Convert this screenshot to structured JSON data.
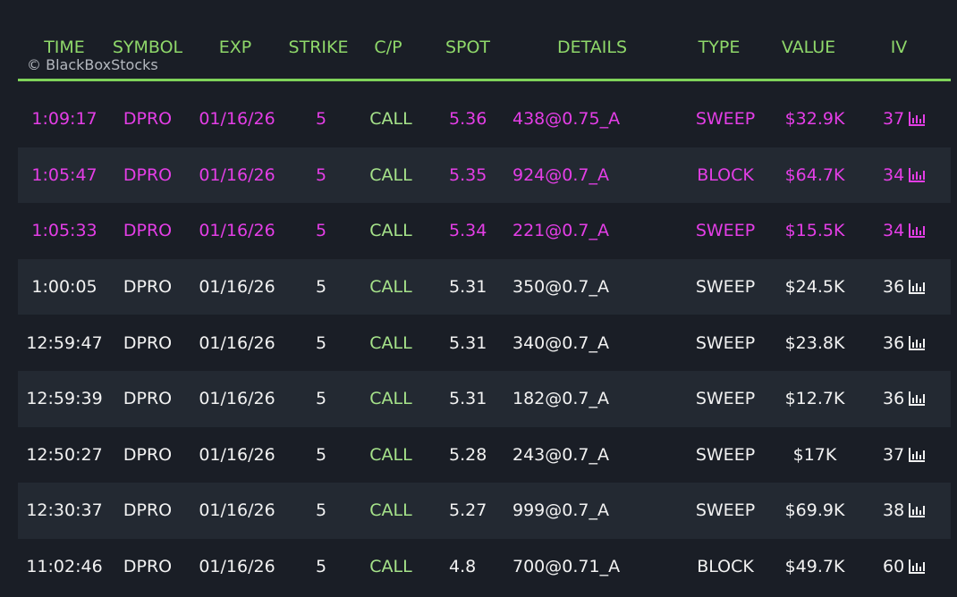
{
  "header": {
    "columns": [
      "TIME",
      "SYMBOL",
      "EXP",
      "STRIKE",
      "C/P",
      "SPOT",
      "DETAILS",
      "TYPE",
      "VALUE",
      "IV"
    ],
    "watermark": "© BlackBoxStocks"
  },
  "colors": {
    "background": "#1a1e26",
    "alt_row": "#232932",
    "header_text": "#8fd86a",
    "divider": "#7fd35a",
    "highlight_row": "#e43ee6",
    "normal_row": "#f2f2f2",
    "call_text": "#a6e38a"
  },
  "rows": [
    {
      "time": "1:09:17",
      "symbol": "DPRO",
      "exp": "01/16/26",
      "strike": "5",
      "cp": "CALL",
      "spot": "5.36",
      "details": "438@0.75_A",
      "type": "SWEEP",
      "value": "$32.9K",
      "iv": "37",
      "icon": "bar-chart-icon",
      "style": "pink"
    },
    {
      "time": "1:05:47",
      "symbol": "DPRO",
      "exp": "01/16/26",
      "strike": "5",
      "cp": "CALL",
      "spot": "5.35",
      "details": "924@0.7_A",
      "type": "BLOCK",
      "value": "$64.7K",
      "iv": "34",
      "icon": "bar-chart-icon",
      "style": "pink"
    },
    {
      "time": "1:05:33",
      "symbol": "DPRO",
      "exp": "01/16/26",
      "strike": "5",
      "cp": "CALL",
      "spot": "5.34",
      "details": "221@0.7_A",
      "type": "SWEEP",
      "value": "$15.5K",
      "iv": "34",
      "icon": "bar-chart-icon",
      "style": "pink"
    },
    {
      "time": "1:00:05",
      "symbol": "DPRO",
      "exp": "01/16/26",
      "strike": "5",
      "cp": "CALL",
      "spot": "5.31",
      "details": "350@0.7_A",
      "type": "SWEEP",
      "value": "$24.5K",
      "iv": "36",
      "icon": "bar-chart-icon",
      "style": "white"
    },
    {
      "time": "12:59:47",
      "symbol": "DPRO",
      "exp": "01/16/26",
      "strike": "5",
      "cp": "CALL",
      "spot": "5.31",
      "details": "340@0.7_A",
      "type": "SWEEP",
      "value": "$23.8K",
      "iv": "36",
      "icon": "bar-chart-icon",
      "style": "white"
    },
    {
      "time": "12:59:39",
      "symbol": "DPRO",
      "exp": "01/16/26",
      "strike": "5",
      "cp": "CALL",
      "spot": "5.31",
      "details": "182@0.7_A",
      "type": "SWEEP",
      "value": "$12.7K",
      "iv": "36",
      "icon": "bar-chart-icon",
      "style": "white"
    },
    {
      "time": "12:50:27",
      "symbol": "DPRO",
      "exp": "01/16/26",
      "strike": "5",
      "cp": "CALL",
      "spot": "5.28",
      "details": "243@0.7_A",
      "type": "SWEEP",
      "value": "$17K",
      "iv": "37",
      "icon": "bar-chart-icon",
      "style": "white"
    },
    {
      "time": "12:30:37",
      "symbol": "DPRO",
      "exp": "01/16/26",
      "strike": "5",
      "cp": "CALL",
      "spot": "5.27",
      "details": "999@0.7_A",
      "type": "SWEEP",
      "value": "$69.9K",
      "iv": "38",
      "icon": "bar-chart-icon",
      "style": "white"
    },
    {
      "time": "11:02:46",
      "symbol": "DPRO",
      "exp": "01/16/26",
      "strike": "5",
      "cp": "CALL",
      "spot": "4.8",
      "details": "700@0.71_A",
      "type": "BLOCK",
      "value": "$49.7K",
      "iv": "60",
      "icon": "bar-chart-icon",
      "style": "white"
    }
  ]
}
